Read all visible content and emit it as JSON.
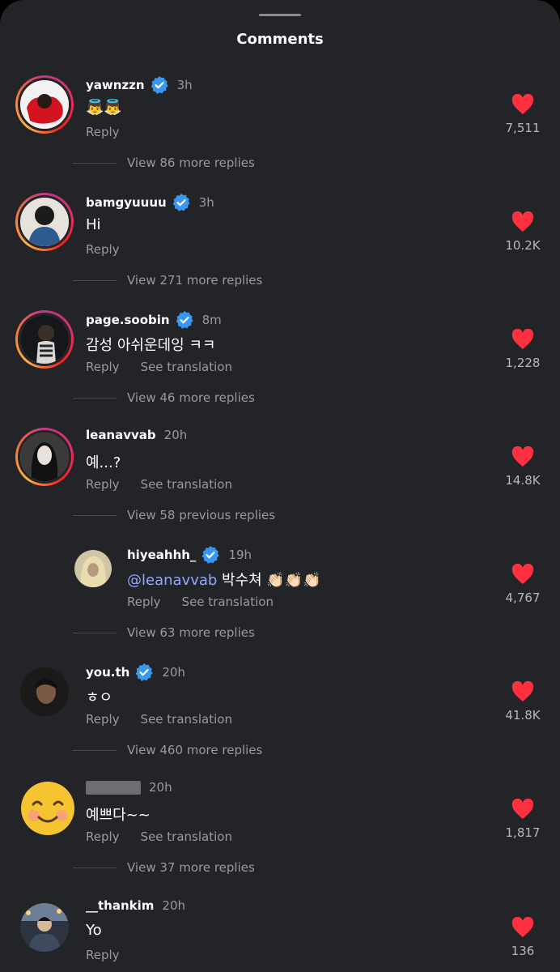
{
  "header": {
    "title": "Comments"
  },
  "icons": {
    "verified": "verified-badge-icon",
    "like": "heart-icon",
    "heart_color": "#ff3040",
    "verified_color": "#3897f0"
  },
  "actions": {
    "reply": "Reply",
    "see_translation": "See translation"
  },
  "comments": [
    {
      "username": "yawnzzn",
      "verified": true,
      "time": "3h",
      "text": "👼👼",
      "likes": "7,511",
      "view_more": "View 86 more replies"
    },
    {
      "username": "bamgyuuuu",
      "verified": true,
      "time": "3h",
      "text": "Hi",
      "likes": "10.2K",
      "view_more": "View 271 more replies"
    },
    {
      "username": "page.soobin",
      "verified": true,
      "time": "8m",
      "text": "감성 아쉬운데잉 ㅋㅋ",
      "likes": "1,228",
      "view_more": "View 46 more replies"
    },
    {
      "username": "leanavvab",
      "verified": false,
      "time": "20h",
      "text": "예...?",
      "likes": "14.8K",
      "view_more": "View 58 previous replies"
    },
    {
      "username": "you.th",
      "verified": true,
      "time": "20h",
      "text": "ㅎㅇ",
      "likes": "41.8K",
      "view_more": "View 460 more replies"
    },
    {
      "username": "",
      "verified": false,
      "time": "20h",
      "text": "예쁘다~~",
      "likes": "1,817",
      "view_more": "View 37 more replies"
    },
    {
      "username": "__thankim",
      "verified": false,
      "time": "20h",
      "text": "Yo",
      "likes": "136"
    }
  ],
  "reply": {
    "username": "hiyeahhh_",
    "verified": true,
    "time": "19h",
    "mention": "@leanavvab",
    "text": " 박수쳐 👏🏻👏🏻👏🏻",
    "likes": "4,767",
    "view_more": "View 63 more replies"
  }
}
